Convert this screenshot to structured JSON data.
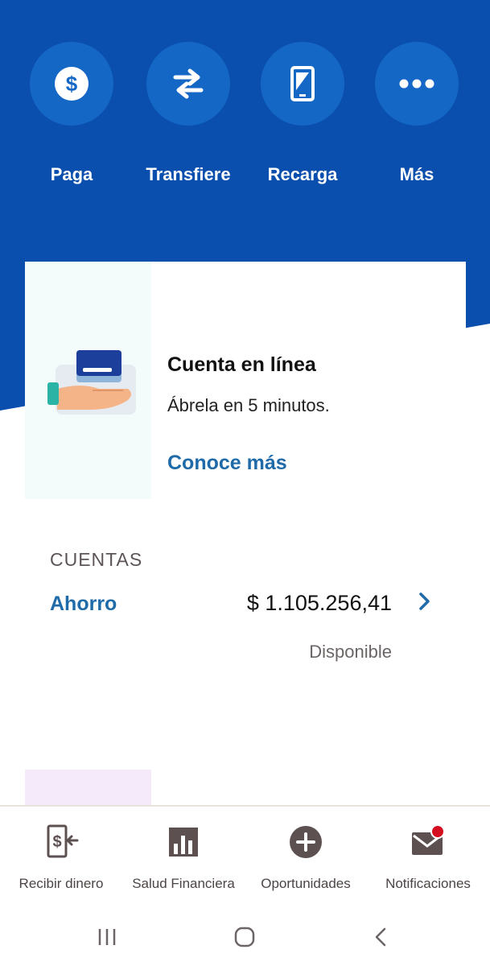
{
  "actions": [
    {
      "label": "Paga",
      "icon": "dollar-icon"
    },
    {
      "label": "Transfiere",
      "icon": "transfer-arrows-icon"
    },
    {
      "label": "Recarga",
      "icon": "phone-icon"
    },
    {
      "label": "Más",
      "icon": "more-dots-icon"
    }
  ],
  "promo": {
    "title": "Cuenta en línea",
    "subtitle": "Ábrela en 5 minutos.",
    "link": "Conoce más",
    "icon": "card-in-hand-icon"
  },
  "accounts": {
    "section_title": "CUENTAS",
    "items": [
      {
        "name": "Ahorro",
        "amount": "$ 1.105.256,41",
        "status": "Disponible"
      }
    ]
  },
  "bottom_nav": [
    {
      "label": "Recibir dinero",
      "icon": "receive-money-icon"
    },
    {
      "label": "Salud Financiera",
      "icon": "bar-chart-icon"
    },
    {
      "label": "Oportunidades",
      "icon": "plus-circle-icon"
    },
    {
      "label": "Notificaciones",
      "icon": "mail-icon",
      "has_badge": true
    }
  ],
  "system_nav": [
    "recent-apps-icon",
    "home-icon",
    "back-icon"
  ],
  "colors": {
    "brand_blue": "#0a4fae",
    "circle_blue": "#1567c6",
    "link_blue": "#1f6aa8",
    "badge_red": "#d40d1f",
    "icon_brown": "#5d5050"
  }
}
